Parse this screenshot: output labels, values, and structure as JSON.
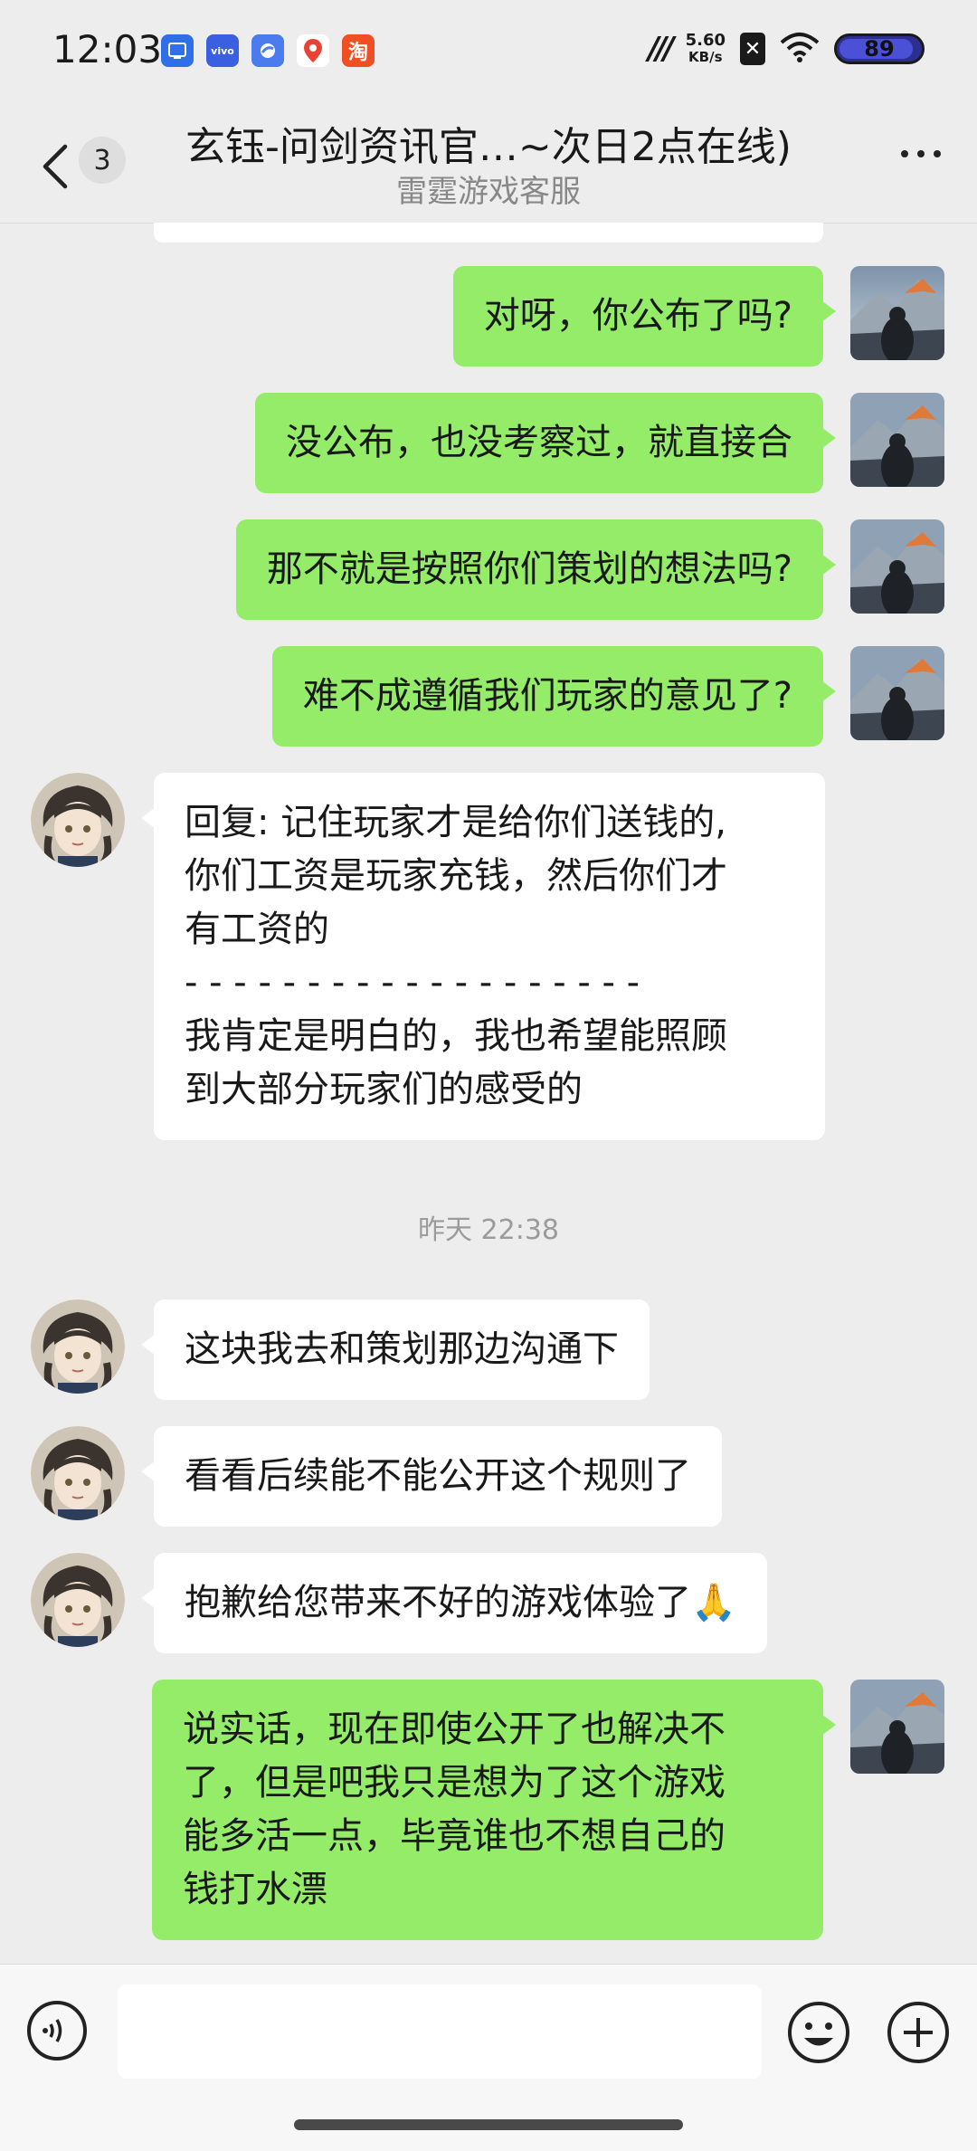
{
  "status_bar": {
    "time": "12:03",
    "net_speed_value": "5.60",
    "net_speed_unit": "KB/s",
    "battery": "89",
    "app_icons": [
      "screenshot-app-icon",
      "vivo-app-icon",
      "browser-app-icon",
      "map-app-icon",
      "taobao-app-icon"
    ],
    "taobao_text": "淘"
  },
  "nav": {
    "unread_count": "3",
    "title": "玄钰-问剑资讯官…~次日2点在线)",
    "subtitle": "雷霆游戏客服"
  },
  "messages": [
    {
      "side": "me",
      "text": "对呀，你公布了吗?"
    },
    {
      "side": "me",
      "text": "没公布，也没考察过，就直接合"
    },
    {
      "side": "me",
      "text": "那不就是按照你们策划的想法吗?"
    },
    {
      "side": "me",
      "text": "难不成遵循我们玩家的意见了?"
    },
    {
      "side": "them",
      "text": "回复: 记住玩家才是给你们送钱的,\n你们工资是玩家充钱，然后你们才\n有工资的\n- - - - - - - - - - - - - - - - - - -\n我肯定是明白的，我也希望能照顾\n到大部分玩家们的感受的"
    },
    {
      "side": "them",
      "text": "这块我去和策划那边沟通下"
    },
    {
      "side": "them",
      "text": "看看后续能不能公开这个规则了"
    },
    {
      "side": "them",
      "text": "抱歉给您带来不好的游戏体验了🙏"
    },
    {
      "side": "me",
      "text": "说实话，现在即使公开了也解决不\n了，但是吧我只是想为了这个游戏\n能多活一点，毕竟谁也不想自己的\n钱打水漂"
    }
  ],
  "timestamp": "昨天 22:38",
  "input": {
    "value": "",
    "placeholder": ""
  },
  "colors": {
    "me_bubble": "#95ec69",
    "them_bubble": "#ffffff",
    "background": "#ededed"
  }
}
